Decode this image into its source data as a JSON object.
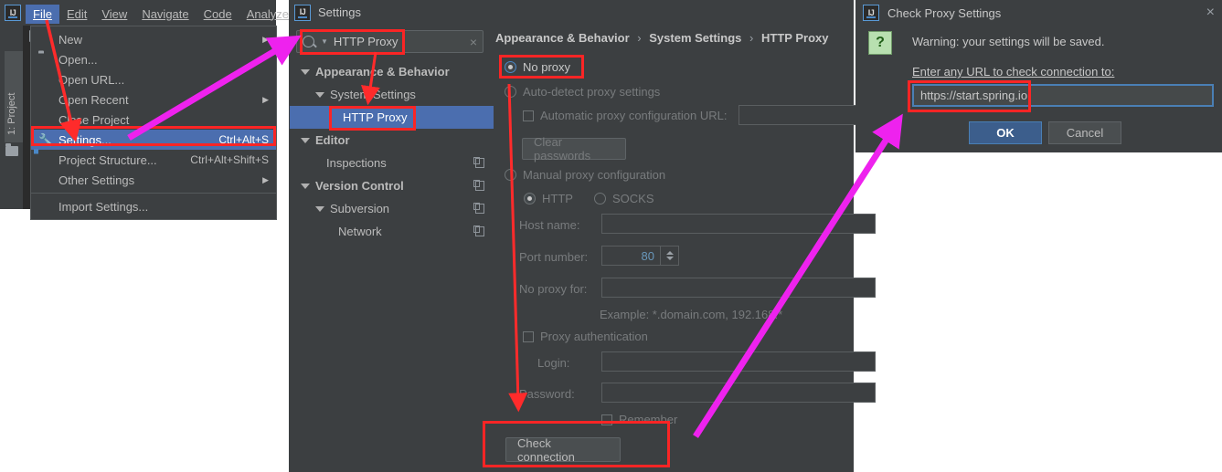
{
  "ide": {
    "logo": "IJ",
    "project_tab": "1: Project",
    "menubar": [
      {
        "label": "File",
        "mnemonic": "F",
        "active": true
      },
      {
        "label": "Edit",
        "mnemonic": "E",
        "active": false
      },
      {
        "label": "View",
        "mnemonic": "V",
        "active": false
      },
      {
        "label": "Navigate",
        "mnemonic": "N",
        "active": false
      },
      {
        "label": "Code",
        "mnemonic": "C",
        "active": false
      },
      {
        "label": "Analyze",
        "mnemonic": "z",
        "active": false
      }
    ]
  },
  "file_menu": {
    "items": [
      {
        "label": "New",
        "shortcut": "",
        "submenu": true,
        "icon": "",
        "selected": false
      },
      {
        "label": "Open...",
        "shortcut": "",
        "submenu": false,
        "icon": "folder-icon",
        "selected": false
      },
      {
        "label": "Open URL...",
        "shortcut": "",
        "submenu": false,
        "icon": "",
        "selected": false
      },
      {
        "label": "Open Recent",
        "shortcut": "",
        "submenu": true,
        "icon": "",
        "selected": false
      },
      {
        "label": "Close Project",
        "shortcut": "",
        "submenu": false,
        "icon": "",
        "selected": false
      },
      {
        "label": "Settings...",
        "shortcut": "Ctrl+Alt+S",
        "submenu": false,
        "icon": "wrench-icon",
        "selected": true
      },
      {
        "label": "Project Structure...",
        "shortcut": "Ctrl+Alt+Shift+S",
        "submenu": false,
        "icon": "module-icon",
        "selected": false
      },
      {
        "label": "Other Settings",
        "shortcut": "",
        "submenu": true,
        "icon": "",
        "selected": false
      },
      {
        "label": "Import Settings...",
        "shortcut": "",
        "submenu": false,
        "icon": "",
        "selected": false
      }
    ]
  },
  "settings": {
    "title": "Settings",
    "logo": "IJ",
    "search": {
      "value": "HTTP Proxy",
      "clear_icon": "×",
      "search_icon": "search-icon"
    },
    "tree": [
      {
        "label": "Appearance & Behavior",
        "depth": 0,
        "expandable": true,
        "bold": true,
        "selected": false,
        "copy_icon": false
      },
      {
        "label": "System Settings",
        "depth": 1,
        "expandable": true,
        "bold": false,
        "selected": false,
        "copy_icon": false
      },
      {
        "label": "HTTP Proxy",
        "depth": 2,
        "expandable": false,
        "bold": false,
        "selected": true,
        "copy_icon": false
      },
      {
        "label": "Editor",
        "depth": 0,
        "expandable": true,
        "bold": true,
        "selected": false,
        "copy_icon": false
      },
      {
        "label": "Inspections",
        "depth": 1,
        "expandable": false,
        "bold": false,
        "selected": false,
        "copy_icon": true
      },
      {
        "label": "Version Control",
        "depth": 0,
        "expandable": true,
        "bold": true,
        "selected": false,
        "copy_icon": true
      },
      {
        "label": "Subversion",
        "depth": 1,
        "expandable": true,
        "bold": false,
        "selected": false,
        "copy_icon": true
      },
      {
        "label": "Network",
        "depth": 2,
        "expandable": false,
        "bold": false,
        "selected": false,
        "copy_icon": true
      }
    ],
    "breadcrumb": [
      "Appearance & Behavior",
      "System Settings",
      "HTTP Proxy"
    ],
    "breadcrumb_sep": "›",
    "proxy": {
      "no_proxy": {
        "label": "No proxy",
        "selected": true
      },
      "auto_detect": {
        "label": "Auto-detect proxy settings",
        "selected": false
      },
      "auto_pac": {
        "label": "Automatic proxy configuration URL:",
        "checked": false,
        "value": ""
      },
      "clear_passwords": "Clear passwords",
      "manual": {
        "label": "Manual proxy configuration",
        "selected": false
      },
      "http": {
        "label": "HTTP",
        "selected": true
      },
      "socks": {
        "label": "SOCKS",
        "selected": false
      },
      "host_name": {
        "label": "Host name:",
        "value": ""
      },
      "port_number": {
        "label": "Port number:",
        "value": "80"
      },
      "no_proxy_for": {
        "label": "No proxy for:",
        "value": ""
      },
      "example_hint": "Example: *.domain.com, 192.168.*",
      "proxy_auth": {
        "label": "Proxy authentication",
        "checked": false
      },
      "login": {
        "label": "Login:",
        "value": ""
      },
      "password": {
        "label": "Password:",
        "value": ""
      },
      "remember": {
        "label": "Remember",
        "checked": false
      },
      "check_connection": "Check connection"
    }
  },
  "check_dialog": {
    "title": "Check Proxy Settings",
    "logo": "IJ",
    "close_icon": "×",
    "icon": "question-icon",
    "icon_glyph": "?",
    "warning": "Warning: your settings will be saved.",
    "prompt": "Enter any URL to check connection to:",
    "url_value": "https://start.spring.io",
    "ok": "OK",
    "cancel": "Cancel"
  },
  "annotations": {
    "highlight_color": "#fa2525",
    "arrow_color": "#ff2b2b",
    "flow_color": "#ee22ee"
  }
}
